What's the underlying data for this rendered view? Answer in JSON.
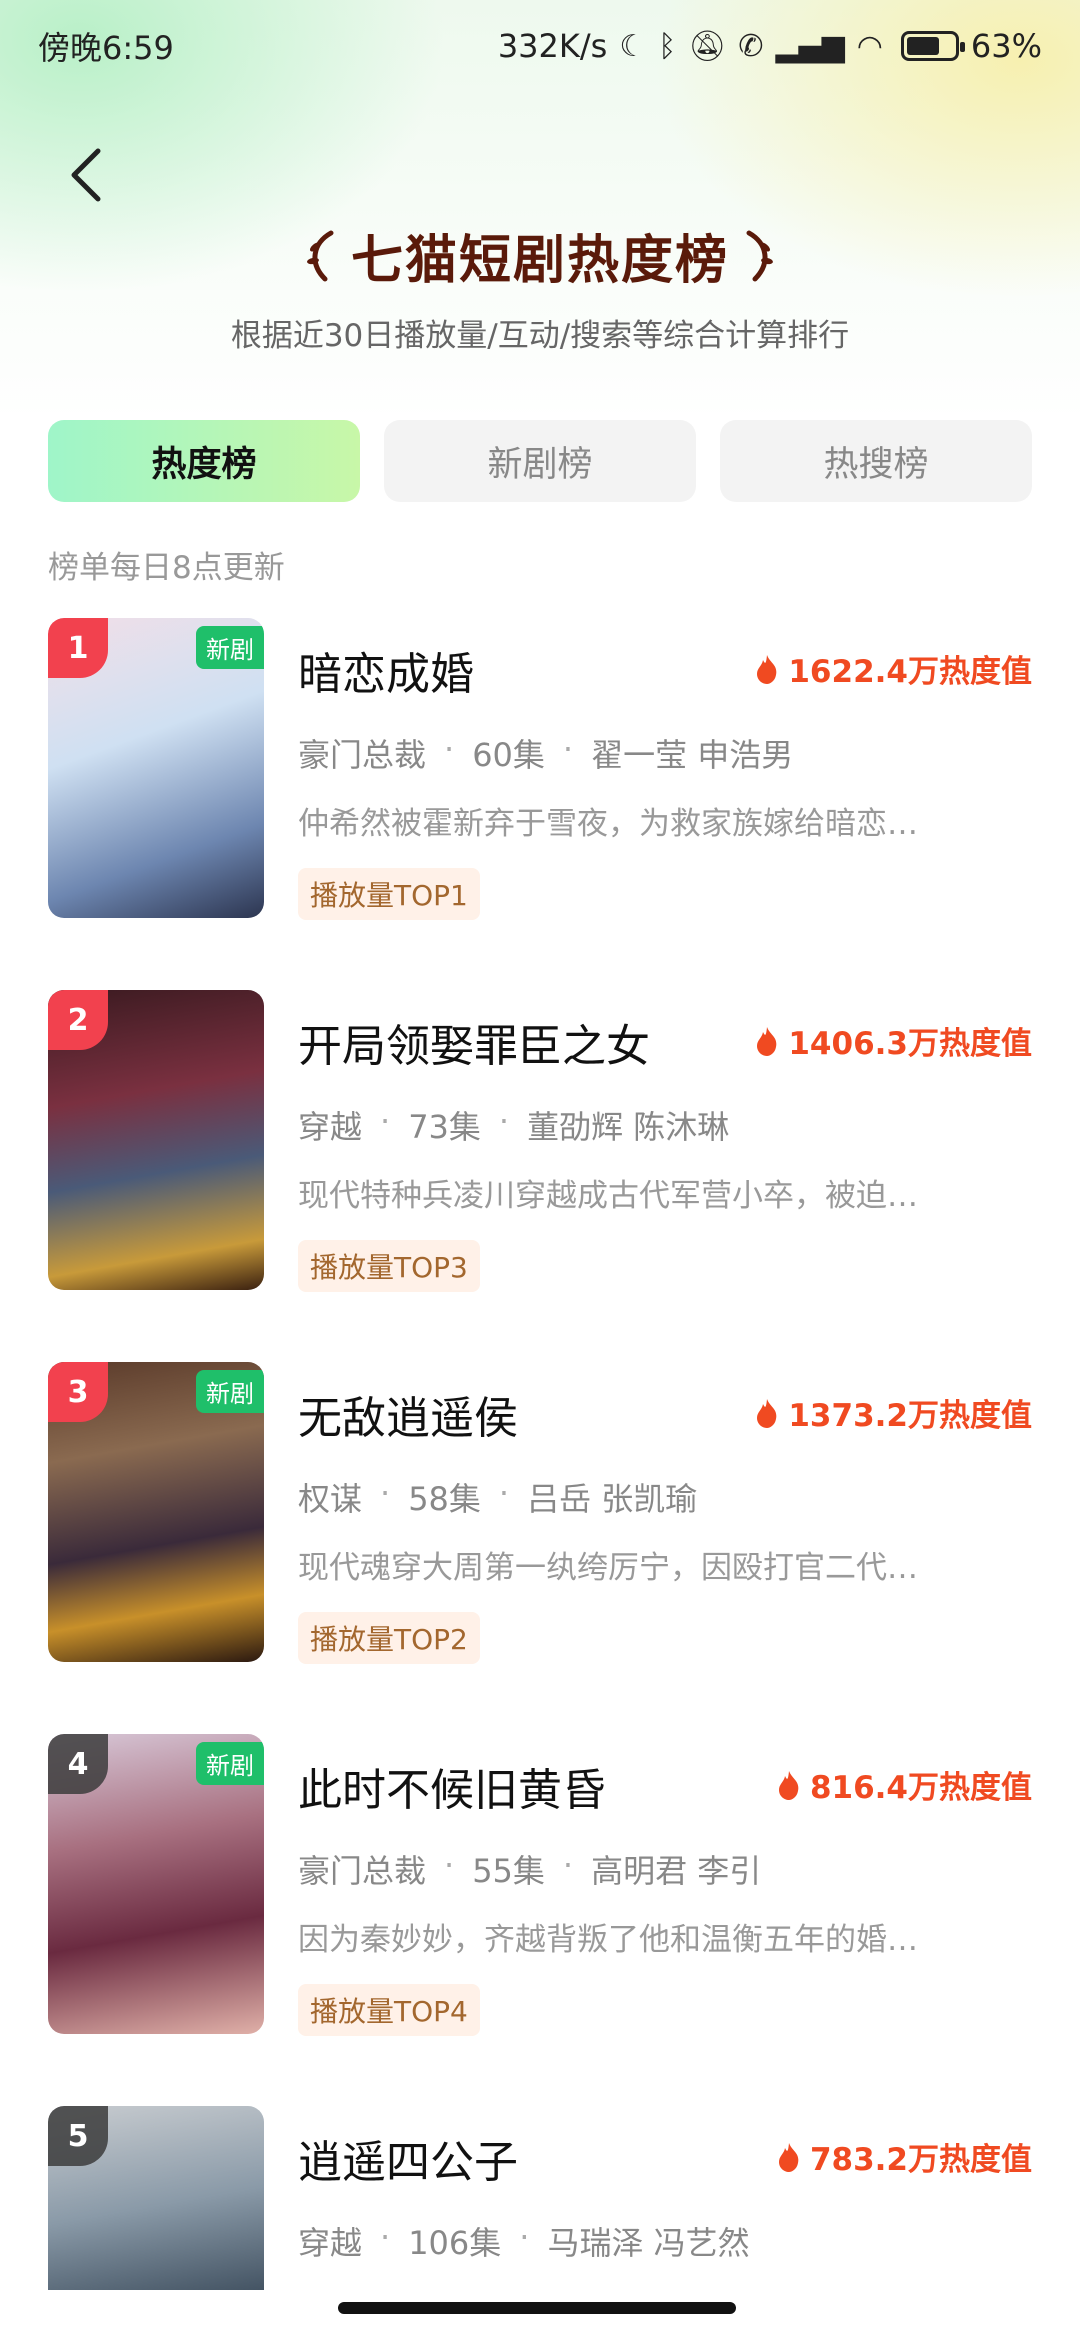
{
  "status_bar": {
    "time": "傍晚6:59",
    "network_speed": "332K/s",
    "battery": "63%"
  },
  "header": {
    "title": "七猫短剧热度榜",
    "subtitle": "根据近30日播放量/互动/搜索等综合计算排行"
  },
  "tabs": [
    {
      "label": "热度榜",
      "active": true
    },
    {
      "label": "新剧榜",
      "active": false
    },
    {
      "label": "热搜榜",
      "active": false
    }
  ],
  "update_note": "榜单每日8点更新",
  "items": [
    {
      "rank": "1",
      "badge": "新剧",
      "name": "暗恋成婚",
      "heat": "1622.4万热度值",
      "genre": "豪门总裁",
      "episodes": "60集",
      "cast": "翟一莹 申浩男",
      "desc": "仲希然被霍新弃于雪夜，为救家族嫁给暗恋…",
      "tag": "播放量TOP1"
    },
    {
      "rank": "2",
      "badge": "",
      "name": "开局领娶罪臣之女",
      "heat": "1406.3万热度值",
      "genre": "穿越",
      "episodes": "73集",
      "cast": "董劭辉 陈沐琳",
      "desc": "现代特种兵凌川穿越成古代军营小卒，被迫…",
      "tag": "播放量TOP3"
    },
    {
      "rank": "3",
      "badge": "新剧",
      "name": "无敌逍遥侯",
      "heat": "1373.2万热度值",
      "genre": "权谋",
      "episodes": "58集",
      "cast": "吕岳 张凯瑜",
      "desc": "现代魂穿大周第一纨绔厉宁，因殴打官二代…",
      "tag": "播放量TOP2"
    },
    {
      "rank": "4",
      "badge": "新剧",
      "name": "此时不候旧黄昏",
      "heat": "816.4万热度值",
      "genre": "豪门总裁",
      "episodes": "55集",
      "cast": "高明君 李引",
      "desc": "因为秦妙妙，齐越背叛了他和温衡五年的婚…",
      "tag": "播放量TOP4"
    },
    {
      "rank": "5",
      "badge": "",
      "name": "逍遥四公子",
      "heat": "783.2万热度值",
      "genre": "穿越",
      "episodes": "106集",
      "cast": "马瑞泽 冯艺然",
      "desc": "",
      "tag": ""
    }
  ]
}
